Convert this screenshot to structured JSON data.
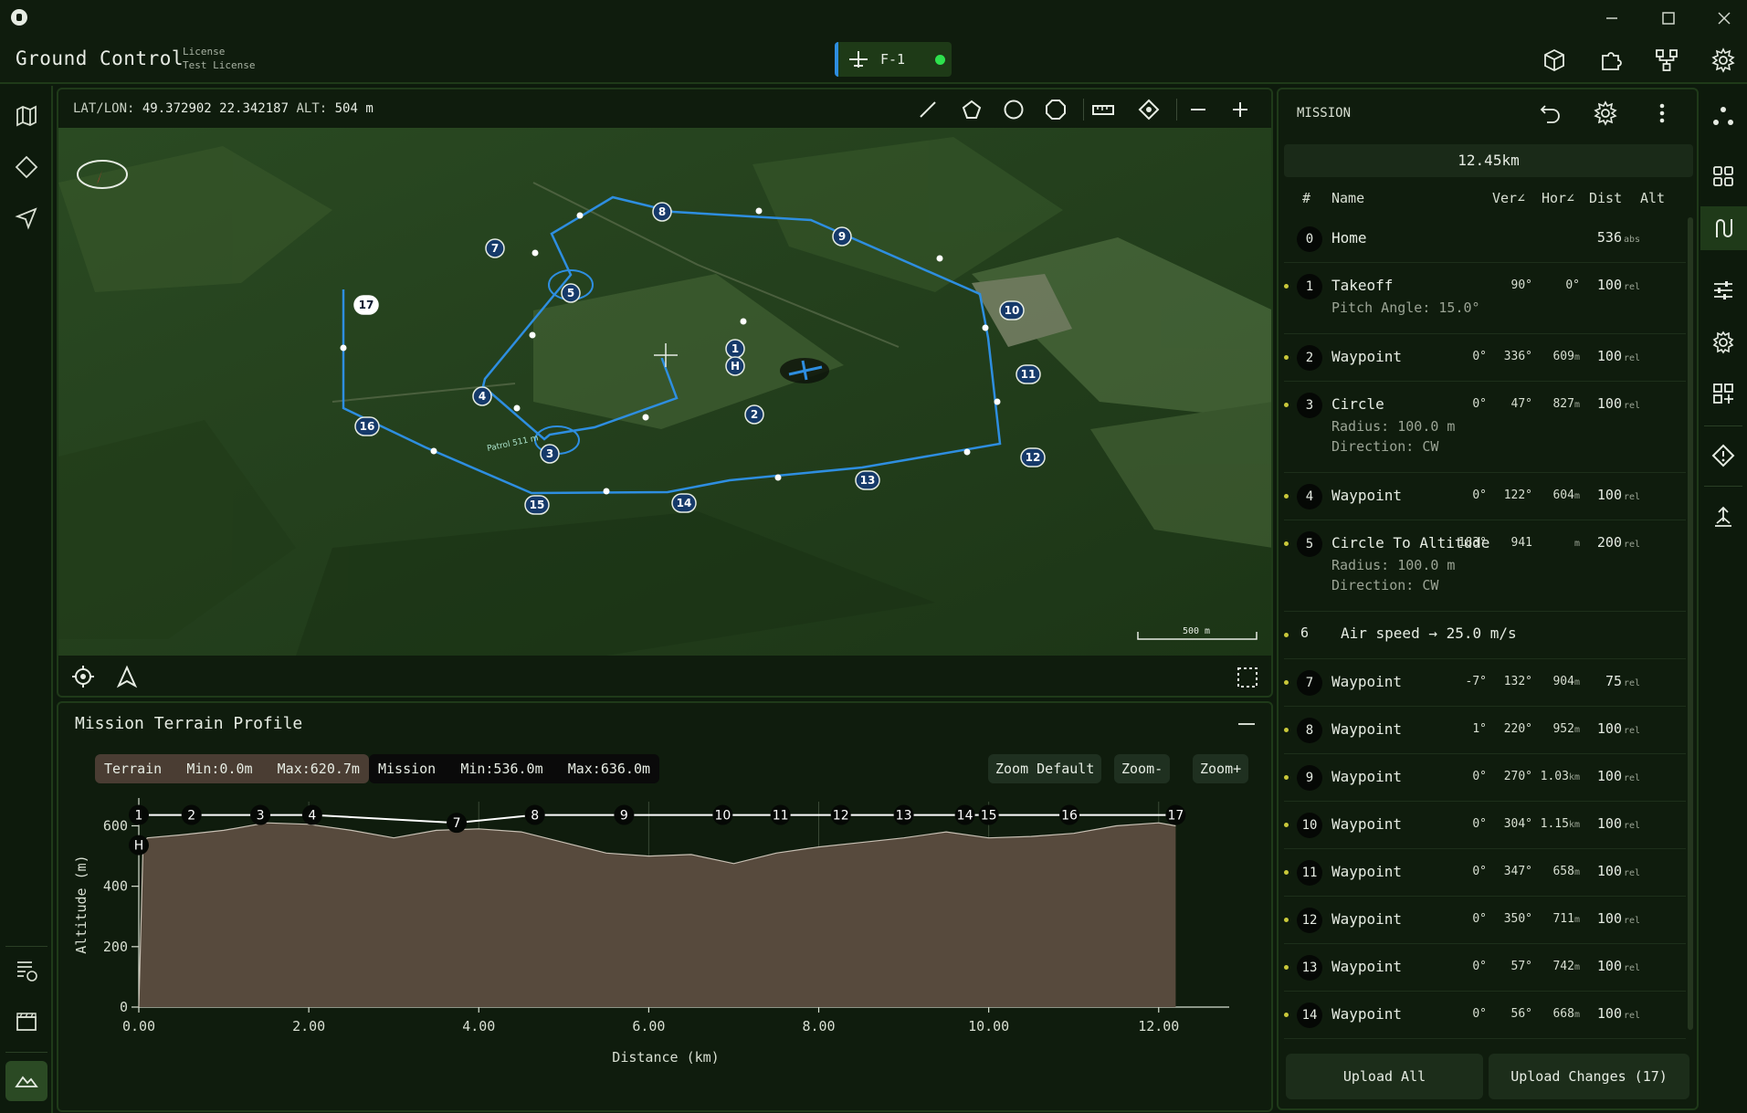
{
  "app": {
    "title": "Ground Control",
    "license_line1": "License",
    "license_line2": "Test License",
    "vehicle": "F-1",
    "vehicle_status_color": "#2ee04d",
    "accent_color": "#2e8ee0",
    "window_buttons": [
      "minimize-icon",
      "maximize-icon",
      "close-icon"
    ],
    "top_icons": [
      "cube-icon",
      "puzzle-icon",
      "network-icon",
      "gear-icon"
    ]
  },
  "map": {
    "latlon_label": "LAT/LON:",
    "latlon_value": "49.372902 22.342187",
    "alt_label": "ALT:",
    "alt_value": "504 m",
    "tools": [
      "line-icon",
      "polygon-icon",
      "circle-icon",
      "octagon-icon",
      "ruler-icon",
      "target-icon",
      "zoom-out-icon",
      "zoom-in-icon"
    ],
    "scale_label": "500 m",
    "waypoints": [
      "1",
      "H",
      "2",
      "3",
      "4",
      "5",
      "7",
      "8",
      "9",
      "10",
      "11",
      "12",
      "13",
      "14",
      "15",
      "16",
      "17"
    ],
    "annotation_3": "Patrol\n511 m",
    "bottom_icons": [
      "locate-icon",
      "navigate-icon",
      "select-area-icon"
    ]
  },
  "terrain": {
    "title": "Mission Terrain Profile",
    "terrain_legend": "Terrain",
    "terrain_min": "Min:0.0m",
    "terrain_max": "Max:620.7m",
    "mission_legend": "Mission",
    "mission_min": "Min:536.0m",
    "mission_max": "Max:636.0m",
    "zoom_default": "Zoom Default",
    "zoom_out": "Zoom-",
    "zoom_in": "Zoom+"
  },
  "chart_data": {
    "type": "area",
    "xlabel": "Distance (km)",
    "ylabel": "Altitude (m)",
    "xlim": [
      0,
      12.4
    ],
    "ylim": [
      0,
      680
    ],
    "xticks": [
      "0.00",
      "2.00",
      "4.00",
      "6.00",
      "8.00",
      "10.00",
      "12.00"
    ],
    "yticks": [
      "0",
      "200",
      "400",
      "600"
    ],
    "series": [
      {
        "name": "Terrain",
        "color": "#574a3d",
        "x": [
          0.0,
          0.05,
          0.1,
          0.5,
          1.0,
          1.5,
          2.0,
          2.5,
          3.0,
          3.5,
          4.0,
          4.5,
          5.0,
          5.5,
          6.0,
          6.5,
          7.0,
          7.5,
          8.0,
          8.5,
          9.0,
          9.5,
          10.0,
          10.5,
          11.0,
          11.5,
          12.0,
          12.2
        ],
        "y": [
          0,
          540,
          560,
          570,
          585,
          610,
          605,
          585,
          560,
          585,
          590,
          580,
          545,
          510,
          500,
          505,
          475,
          510,
          530,
          545,
          560,
          580,
          560,
          565,
          575,
          600,
          610,
          600
        ]
      },
      {
        "name": "Mission",
        "color": "#ffffff",
        "x": [
          0.0,
          0.62,
          1.43,
          2.04,
          3.74,
          4.66,
          5.71,
          6.87,
          7.55,
          8.26,
          9.0,
          9.72,
          10.0,
          10.95,
          12.2
        ],
        "y": [
          636,
          636,
          636,
          636,
          610,
          636,
          636,
          636,
          636,
          636,
          636,
          636,
          636,
          636,
          636
        ]
      }
    ],
    "point_labels": [
      {
        "label": "1",
        "x": 0.0,
        "y": 636
      },
      {
        "label": "H",
        "x": 0.0,
        "y": 536
      },
      {
        "label": "2",
        "x": 0.62,
        "y": 636
      },
      {
        "label": "3",
        "x": 1.43,
        "y": 636
      },
      {
        "label": "4",
        "x": 2.04,
        "y": 636
      },
      {
        "label": "7",
        "x": 3.74,
        "y": 610
      },
      {
        "label": "8",
        "x": 4.66,
        "y": 636
      },
      {
        "label": "9",
        "x": 5.71,
        "y": 636
      },
      {
        "label": "10",
        "x": 6.87,
        "y": 636
      },
      {
        "label": "11",
        "x": 7.55,
        "y": 636
      },
      {
        "label": "12",
        "x": 8.26,
        "y": 636
      },
      {
        "label": "13",
        "x": 9.0,
        "y": 636
      },
      {
        "label": "14",
        "x": 9.72,
        "y": 636
      },
      {
        "label": "15",
        "x": 10.0,
        "y": 636
      },
      {
        "label": "16",
        "x": 10.95,
        "y": 636
      },
      {
        "label": "17",
        "x": 12.2,
        "y": 636
      }
    ],
    "grid": true
  },
  "mission": {
    "title": "MISSION",
    "total_distance": "12.45km",
    "headers": {
      "num": "#",
      "name": "Name",
      "ver": "Ver∠",
      "hor": "Hor∠",
      "dist": "Dist",
      "alt": "Alt"
    },
    "rows": [
      {
        "num": "0",
        "name": "Home",
        "ver": "",
        "hor": "",
        "dist": "",
        "dist_unit": "",
        "alt": "536",
        "unit": "abs"
      },
      {
        "num": "1",
        "name": "Takeoff",
        "sub1": "Pitch Angle: 15.0°",
        "ver": "",
        "hor": "90°",
        "dist": "0°",
        "dist_unit": "",
        "alt": "100",
        "unit": "rel"
      },
      {
        "num": "2",
        "name": "Waypoint",
        "ver": "0°",
        "hor": "336°",
        "dist": "609",
        "dist_unit": "m",
        "alt": "100",
        "unit": "rel"
      },
      {
        "num": "3",
        "name": "Circle",
        "sub1": "Radius: 100.0 m",
        "sub2": "Direction: CW",
        "ver": "0°",
        "hor": "47°",
        "dist": "827",
        "dist_unit": "m",
        "alt": "100",
        "unit": "rel"
      },
      {
        "num": "4",
        "name": "Waypoint",
        "ver": "0°",
        "hor": "122°",
        "dist": "604",
        "dist_unit": "m",
        "alt": "100",
        "unit": "rel"
      },
      {
        "num": "5",
        "name": "Circle To Altitude",
        "sub1": "Radius: 100.0 m",
        "sub2": "Direction: CW",
        "ver": "183°",
        "hor": "941",
        "dist": "",
        "dist_unit": "m",
        "alt": "200",
        "unit": "rel"
      },
      {
        "num": "6",
        "name": "Air speed → 25.0 m/s"
      },
      {
        "num": "7",
        "name": "Waypoint",
        "ver": "-7°",
        "hor": "132°",
        "dist": "904",
        "dist_unit": "m",
        "alt": "75",
        "unit": "rel"
      },
      {
        "num": "8",
        "name": "Waypoint",
        "ver": "1°",
        "hor": "220°",
        "dist": "952",
        "dist_unit": "m",
        "alt": "100",
        "unit": "rel"
      },
      {
        "num": "9",
        "name": "Waypoint",
        "ver": "0°",
        "hor": "270°",
        "dist": "1.03",
        "dist_unit": "km",
        "alt": "100",
        "unit": "rel"
      },
      {
        "num": "10",
        "name": "Waypoint",
        "ver": "0°",
        "hor": "304°",
        "dist": "1.15",
        "dist_unit": "km",
        "alt": "100",
        "unit": "rel"
      },
      {
        "num": "11",
        "name": "Waypoint",
        "ver": "0°",
        "hor": "347°",
        "dist": "658",
        "dist_unit": "m",
        "alt": "100",
        "unit": "rel"
      },
      {
        "num": "12",
        "name": "Waypoint",
        "ver": "0°",
        "hor": "350°",
        "dist": "711",
        "dist_unit": "m",
        "alt": "100",
        "unit": "rel"
      },
      {
        "num": "13",
        "name": "Waypoint",
        "ver": "0°",
        "hor": "57°",
        "dist": "742",
        "dist_unit": "m",
        "alt": "100",
        "unit": "rel"
      },
      {
        "num": "14",
        "name": "Waypoint",
        "ver": "0°",
        "hor": "56°",
        "dist": "668",
        "dist_unit": "m",
        "alt": "100",
        "unit": "rel"
      }
    ],
    "upload_all": "Upload All",
    "upload_changes": "Upload Changes (17)"
  },
  "left_rail_icons": [
    "map-icon",
    "diamond-icon",
    "send-icon",
    "log-icon",
    "clapper-icon",
    "terrain-icon"
  ],
  "right_rail_icons": [
    "nodes-icon",
    "grid-icon",
    "route-icon",
    "sliders-icon",
    "gear-icon",
    "add-widget-icon",
    "warning-diamond-icon",
    "landing-icon"
  ]
}
